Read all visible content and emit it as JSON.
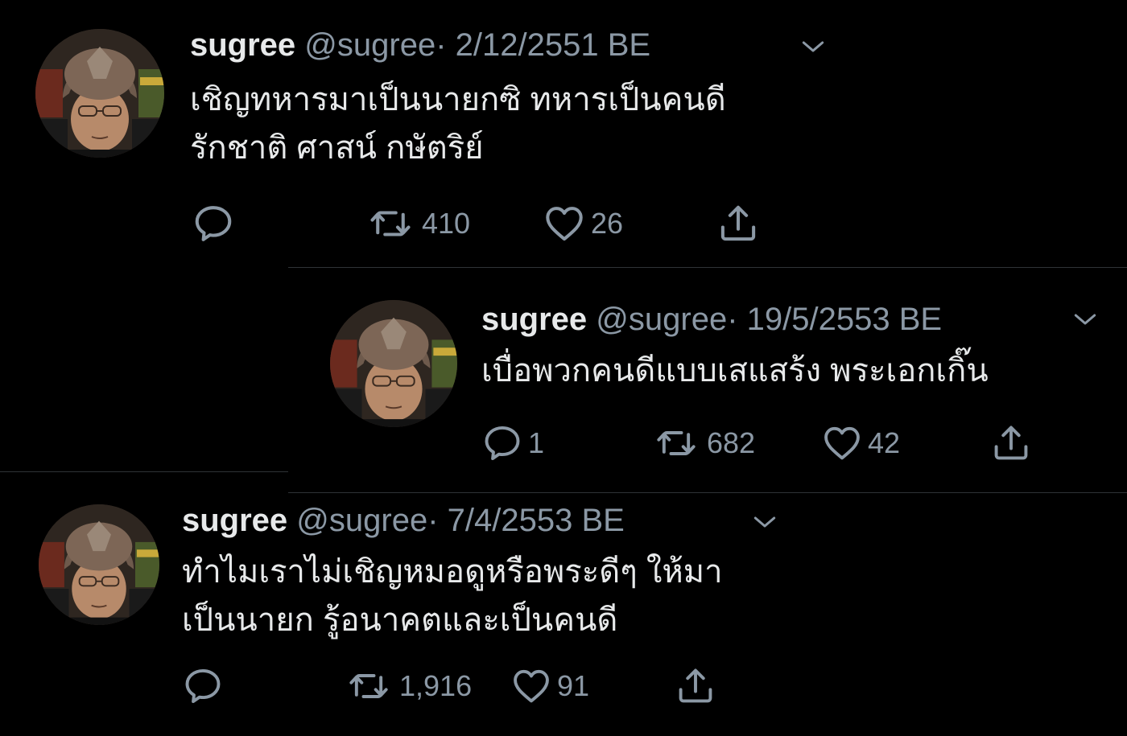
{
  "colors": {
    "background": "#000000",
    "name_text": "#e7e9ea",
    "secondary_text": "#8b98a5",
    "divider": "#2f3336"
  },
  "tweets": [
    {
      "name": "sugree",
      "handle": "@sugree",
      "separator": "·",
      "date": "2/12/2551 BE",
      "text_lines": [
        "เชิญทหารมาเป็นนายกซิ ทหารเป็นคนดี",
        "รักชาติ ศาสน์ กษัตริย์"
      ],
      "actions": {
        "reply_icon": "reply-icon",
        "reply_count": "",
        "retweet_icon": "retweet-icon",
        "retweet_count": "410",
        "like_icon": "heart-icon",
        "like_count": "26",
        "share_icon": "share-icon"
      }
    },
    {
      "name": "sugree",
      "handle": "@sugree",
      "separator": "·",
      "date": "19/5/2553 BE",
      "text_lines": [
        "เบื่อพวกคนดีแบบเสแสร้ง พระเอกเกิ๊น"
      ],
      "actions": {
        "reply_icon": "reply-icon",
        "reply_count": "1",
        "retweet_icon": "retweet-icon",
        "retweet_count": "682",
        "like_icon": "heart-icon",
        "like_count": "42",
        "share_icon": "share-icon"
      }
    },
    {
      "name": "sugree",
      "handle": "@sugree",
      "separator": "·",
      "date": "7/4/2553 BE",
      "text_lines": [
        "ทำไมเราไม่เชิญหมอดูหรือพระดีๆ ให้มา",
        "เป็นนายก รู้อนาคตและเป็นคนดี"
      ],
      "actions": {
        "reply_icon": "reply-icon",
        "reply_count": "",
        "retweet_icon": "retweet-icon",
        "retweet_count": "1,916",
        "like_icon": "heart-icon",
        "like_count": "91",
        "share_icon": "share-icon"
      }
    }
  ]
}
